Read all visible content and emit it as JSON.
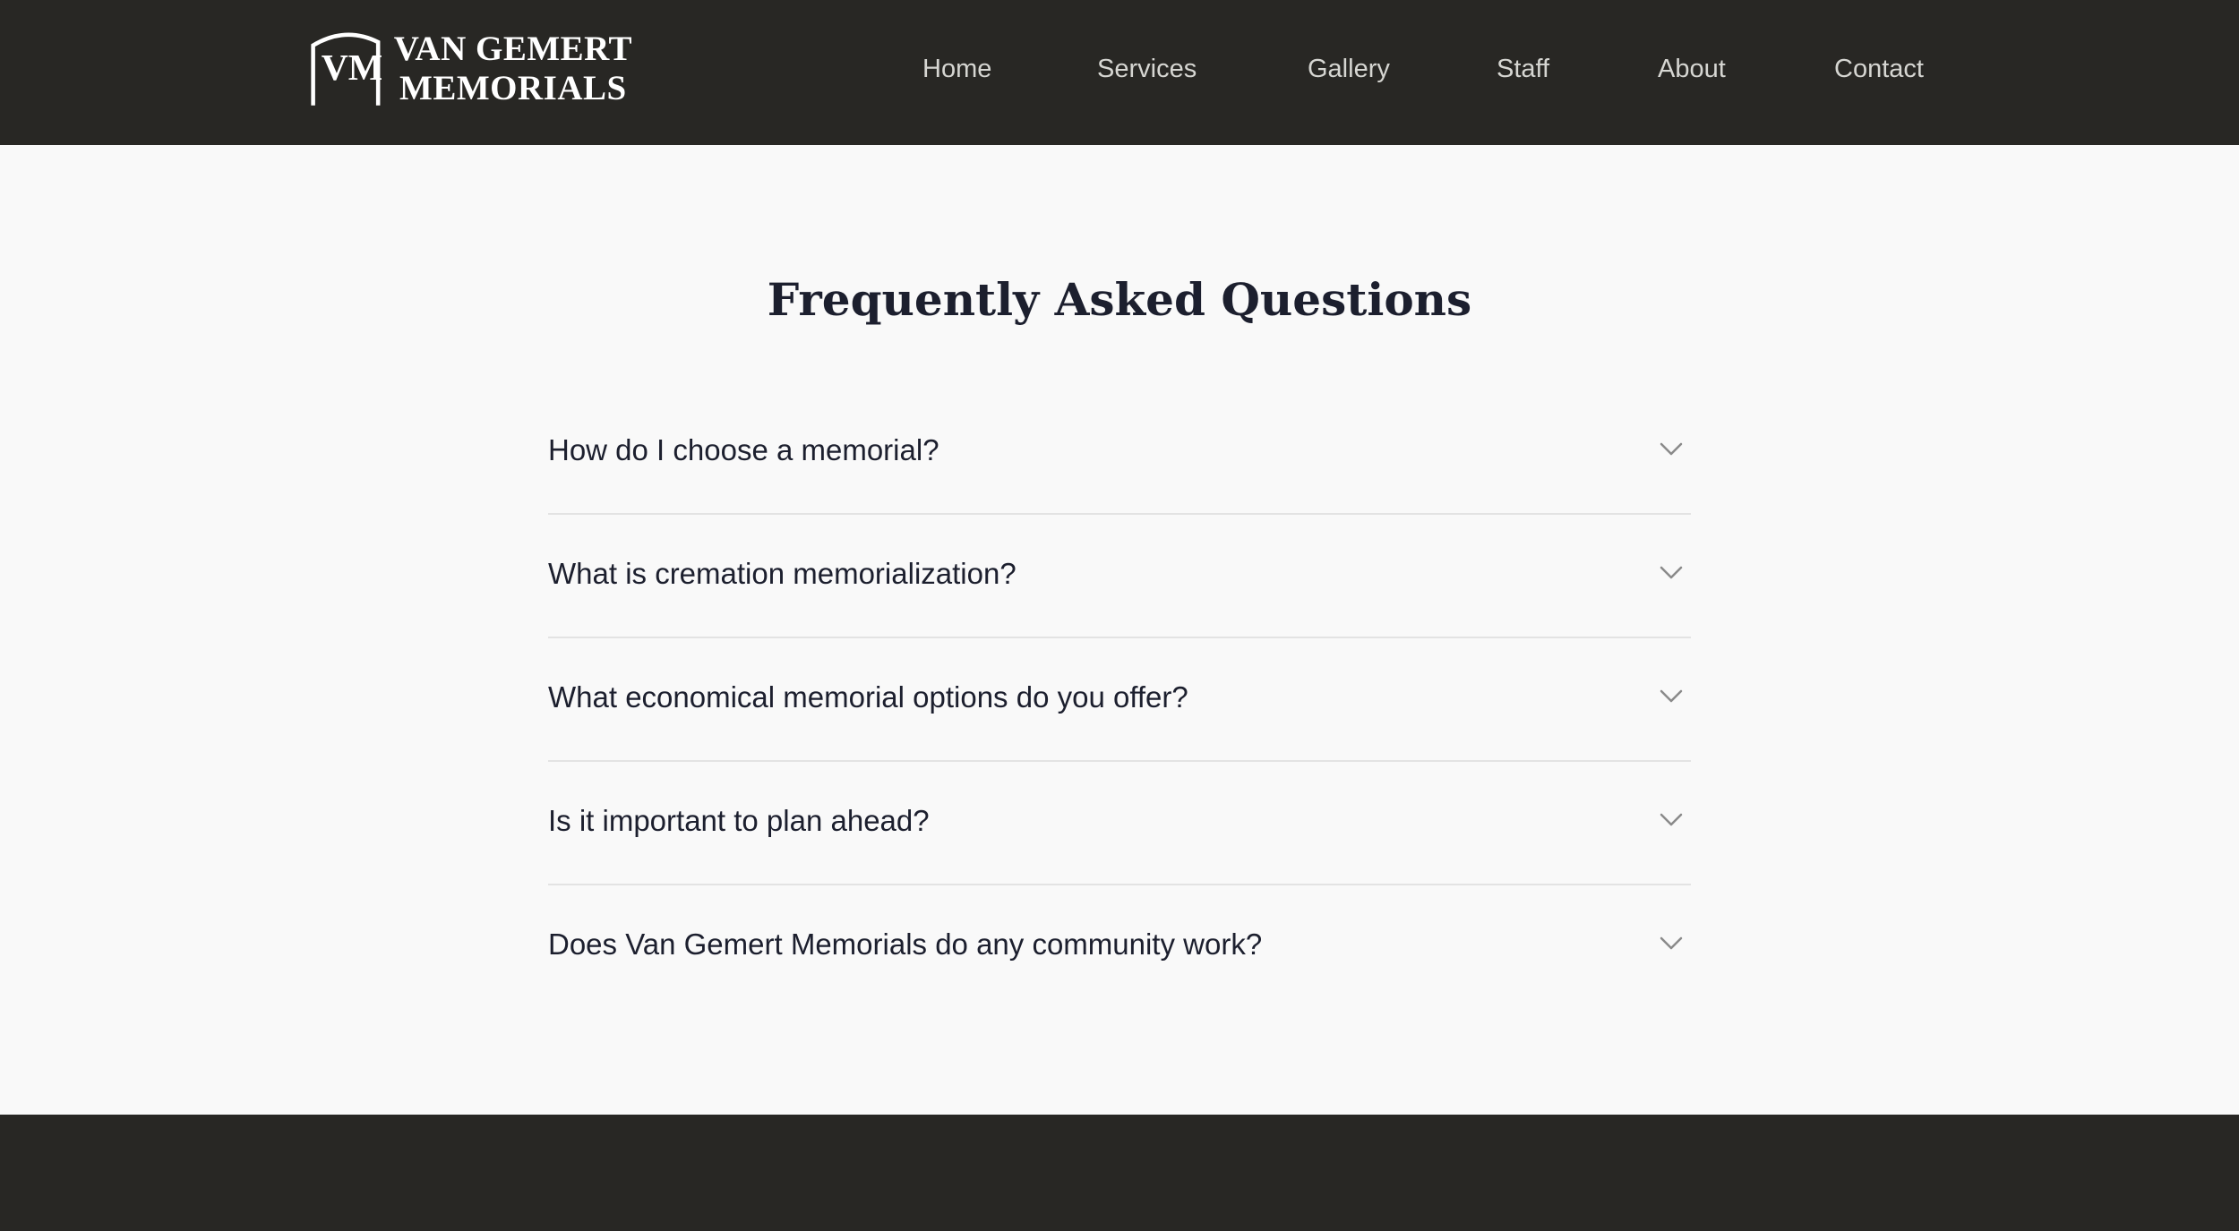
{
  "brand": {
    "name_line1": "VAN GEMERT",
    "name_line2": "MEMORIALS",
    "monogram": "VM",
    "logo_icon": "vm-monogram-logo"
  },
  "nav": {
    "items": [
      {
        "label": "Home"
      },
      {
        "label": "Services"
      },
      {
        "label": "Gallery"
      },
      {
        "label": "Staff"
      },
      {
        "label": "About"
      },
      {
        "label": "Contact"
      }
    ]
  },
  "faq": {
    "title": "Frequently Asked Questions",
    "expand_icon": "chevron-down-icon",
    "items": [
      {
        "question": "How do I choose a memorial?"
      },
      {
        "question": "What is cremation memorialization?"
      },
      {
        "question": "What economical memorial options do you offer?"
      },
      {
        "question": "Is it important to plan ahead?"
      },
      {
        "question": "Does Van Gemert Memorials do any community work?"
      }
    ]
  },
  "colors": {
    "header_bg": "#282724",
    "page_bg": "#f9f9f9",
    "text_dark": "#1c1f2e",
    "nav_text": "#d6d6d2",
    "divider": "#e3e3e3",
    "chevron": "#8a8a8a"
  }
}
